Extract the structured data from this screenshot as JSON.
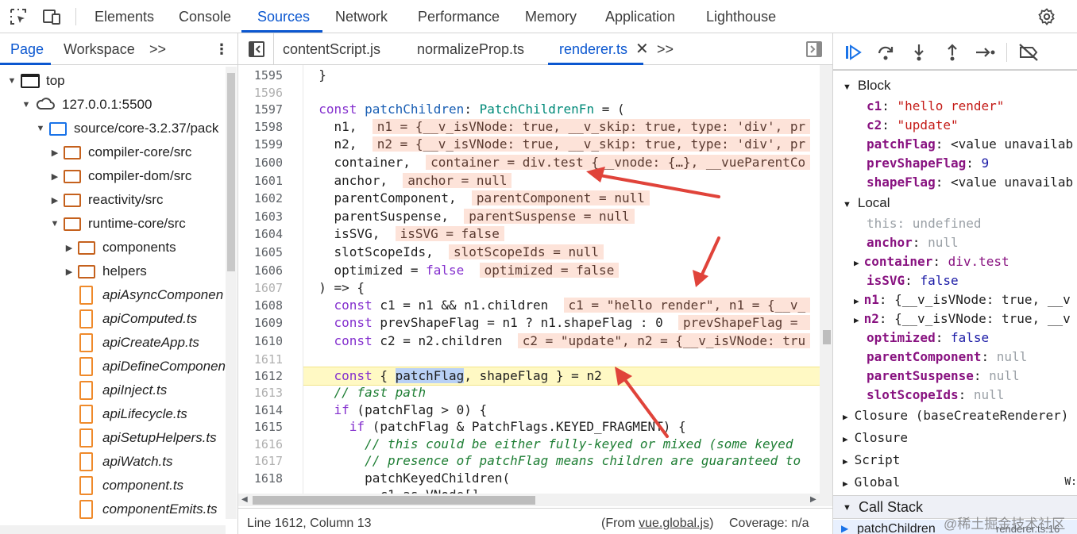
{
  "topbar": {
    "tabs": [
      "Elements",
      "Console",
      "Sources",
      "Network",
      "Performance",
      "Memory",
      "Application",
      "Lighthouse"
    ],
    "active_tab": "Sources"
  },
  "navigator": {
    "tabs": [
      "Page",
      "Workspace"
    ],
    "more": ">>",
    "tree": [
      {
        "label": "top",
        "kind": "frame"
      },
      {
        "label": "127.0.0.1:5500",
        "kind": "cloud"
      },
      {
        "label": "source/core-3.2.37/pack",
        "kind": "folder-blue"
      },
      {
        "label": "compiler-core/src",
        "kind": "folder"
      },
      {
        "label": "compiler-dom/src",
        "kind": "folder"
      },
      {
        "label": "reactivity/src",
        "kind": "folder"
      },
      {
        "label": "runtime-core/src",
        "kind": "folder"
      },
      {
        "label": "components",
        "kind": "folder"
      },
      {
        "label": "helpers",
        "kind": "folder"
      },
      {
        "label": "apiAsyncComponen",
        "kind": "file"
      },
      {
        "label": "apiComputed.ts",
        "kind": "file"
      },
      {
        "label": "apiCreateApp.ts",
        "kind": "file"
      },
      {
        "label": "apiDefineComponen",
        "kind": "file"
      },
      {
        "label": "apiInject.ts",
        "kind": "file"
      },
      {
        "label": "apiLifecycle.ts",
        "kind": "file"
      },
      {
        "label": "apiSetupHelpers.ts",
        "kind": "file"
      },
      {
        "label": "apiWatch.ts",
        "kind": "file"
      },
      {
        "label": "component.ts",
        "kind": "file"
      },
      {
        "label": "componentEmits.ts",
        "kind": "file"
      }
    ]
  },
  "editor": {
    "file_tabs": [
      "contentScript.js",
      "normalizeProp.ts",
      "renderer.ts"
    ],
    "active_file": "renderer.ts",
    "more": ">>",
    "line_numbers": [
      "1595",
      "1596",
      "1597",
      "1598",
      "1599",
      "1600",
      "1601",
      "1602",
      "1603",
      "1604",
      "1605",
      "1606",
      "1607",
      "1608",
      "1609",
      "1610",
      "1611",
      "1612",
      "1613",
      "1614",
      "1615",
      "1616",
      "1617",
      "1618"
    ],
    "status_left": "Line 1612, Column 13",
    "status_from": "(From ",
    "status_link": "vue.global.js",
    "status_from_end": ")",
    "status_coverage": "Coverage: n/a"
  },
  "scope": {
    "block_label": "Block",
    "block": [
      {
        "k": "c1",
        "v": "\"hello render\""
      },
      {
        "k": "c2",
        "v": "\"update\""
      },
      {
        "k": "patchFlag",
        "v": "<value unavailab"
      },
      {
        "k": "prevShapeFlag",
        "v": "9"
      },
      {
        "k": "shapeFlag",
        "v": "<value unavailab"
      }
    ],
    "local_label": "Local",
    "local": [
      {
        "k": "this",
        "v": "undefined"
      },
      {
        "k": "anchor",
        "v": "null"
      },
      {
        "k": "container",
        "v": "div.test"
      },
      {
        "k": "isSVG",
        "v": "false"
      },
      {
        "k": "n1",
        "v": "{__v_isVNode: true, __v"
      },
      {
        "k": "n2",
        "v": "{__v_isVNode: true, __v"
      },
      {
        "k": "optimized",
        "v": "false"
      },
      {
        "k": "parentComponent",
        "v": "null"
      },
      {
        "k": "parentSuspense",
        "v": "null"
      },
      {
        "k": "slotScopeIds",
        "v": "null"
      }
    ],
    "closure1": "Closure (baseCreateRenderer)",
    "closure2": "Closure",
    "script": "Script",
    "global": "Global",
    "global_value": "W:",
    "call_stack": "Call Stack",
    "call_frame": "patchChildren",
    "call_frame_loc": "renderer.ts:16"
  },
  "watermark": "@稀土掘金技术社区"
}
